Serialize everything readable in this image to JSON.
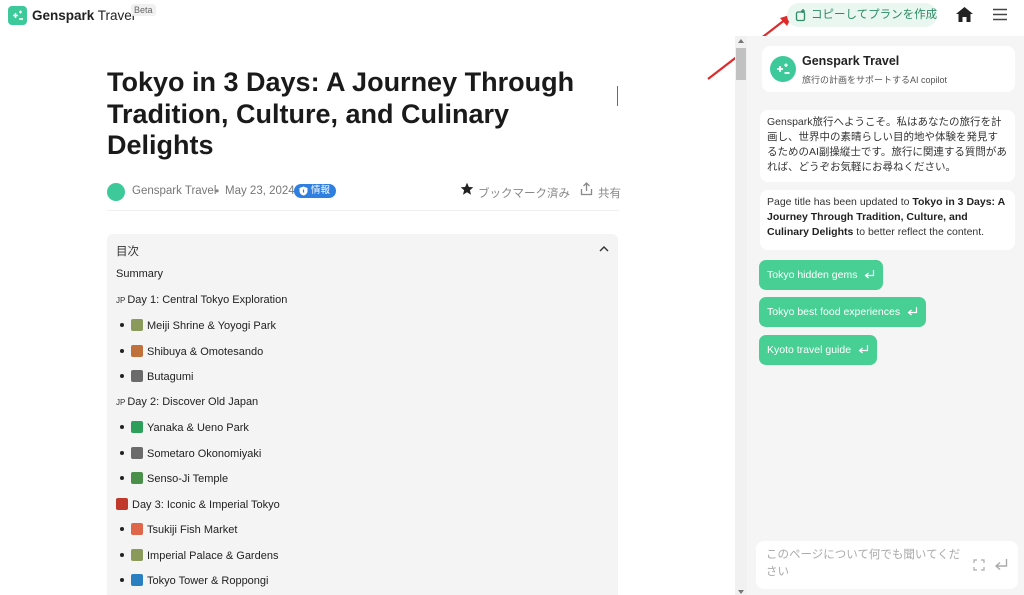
{
  "header": {
    "brand_name": "Genspark",
    "brand_suffix": "Travel",
    "beta": "Beta",
    "copy_plan_label": "コピーしてプランを作成"
  },
  "article": {
    "title": "Tokyo in 3 Days: A Journey Through Tradition, Culture, and Culinary Delights",
    "author": "Genspark Travel",
    "separator": "•",
    "date": "May 23, 2024",
    "tag": "情報",
    "bookmark_label": "ブックマーク済み",
    "share_label": "共有"
  },
  "toc": {
    "heading": "目次",
    "items": [
      {
        "level": 0,
        "prefix": "",
        "label": "Summary"
      },
      {
        "level": 0,
        "prefix": "JP",
        "label": "Day 1: Central Tokyo Exploration"
      },
      {
        "level": 1,
        "icon": "shrine-icon",
        "label": "Meiji Shrine & Yoyogi Park"
      },
      {
        "level": 1,
        "icon": "person-walking-icon",
        "label": "Shibuya & Omotesando"
      },
      {
        "level": 1,
        "icon": "framed-picture-icon",
        "label": "Butagumi"
      },
      {
        "level": 0,
        "prefix": "JP",
        "label": "Day 2: Discover Old Japan"
      },
      {
        "level": 1,
        "icon": "house-icon",
        "label": "Yanaka & Ueno Park"
      },
      {
        "level": 1,
        "icon": "framed-picture-icon",
        "label": "Sometaro Okonomiyaki"
      },
      {
        "level": 1,
        "icon": "temple-icon",
        "label": "Senso-Ji Temple"
      },
      {
        "level": 0,
        "prefix": "tower",
        "label": "Day 3: Iconic & Imperial Tokyo"
      },
      {
        "level": 1,
        "icon": "sushi-icon",
        "label": "Tsukiji Fish Market"
      },
      {
        "level": 1,
        "icon": "shrine-icon",
        "label": "Imperial Palace & Gardens"
      },
      {
        "level": 1,
        "icon": "tower-icon",
        "label": "Tokyo Tower & Roppongi"
      }
    ]
  },
  "sidebar": {
    "assistant_name": "Genspark Travel",
    "assistant_subtitle": "旅行の計画をサポートするAI copilot",
    "welcome_message": "Genspark旅行へようこそ。私はあなたの旅行を計画し、世界中の素晴らしい目的地や体験を発見するためのAI副操縦士です。旅行に関連する質問があれば、どうぞお気軽にお尋ねください。",
    "update_prefix": "Page title has been updated to ",
    "update_title": "Tokyo in 3 Days: A Journey Through Tradition, Culture, and Culinary Delights",
    "update_suffix": " to better reflect the content.",
    "suggestions": [
      "Tokyo hidden gems",
      "Tokyo best food experiences",
      "Kyoto travel guide"
    ],
    "input_placeholder": "このページについて何でも聞いてください"
  },
  "colors": {
    "brand_green": "#3ec99a",
    "chip_green": "#48cf94",
    "tag_blue": "#2f7fe0",
    "arrow_red": "#e02a2a"
  }
}
